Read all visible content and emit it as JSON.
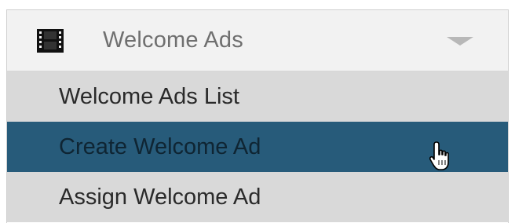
{
  "menu": {
    "header": {
      "label": "Welcome Ads",
      "icon": "film-icon",
      "toggle_icon": "chevron-down-icon"
    },
    "items": [
      {
        "label": "Welcome Ads List",
        "active": false
      },
      {
        "label": "Create Welcome Ad",
        "active": true
      },
      {
        "label": "Assign Welcome Ad",
        "active": false
      }
    ],
    "colors": {
      "header_bg": "#f2f2f2",
      "submenu_bg": "#d9d9d9",
      "active_bg": "#275b7a",
      "header_text": "#6f6f6f"
    }
  },
  "cursor": {
    "icon": "hand-pointer-icon"
  }
}
